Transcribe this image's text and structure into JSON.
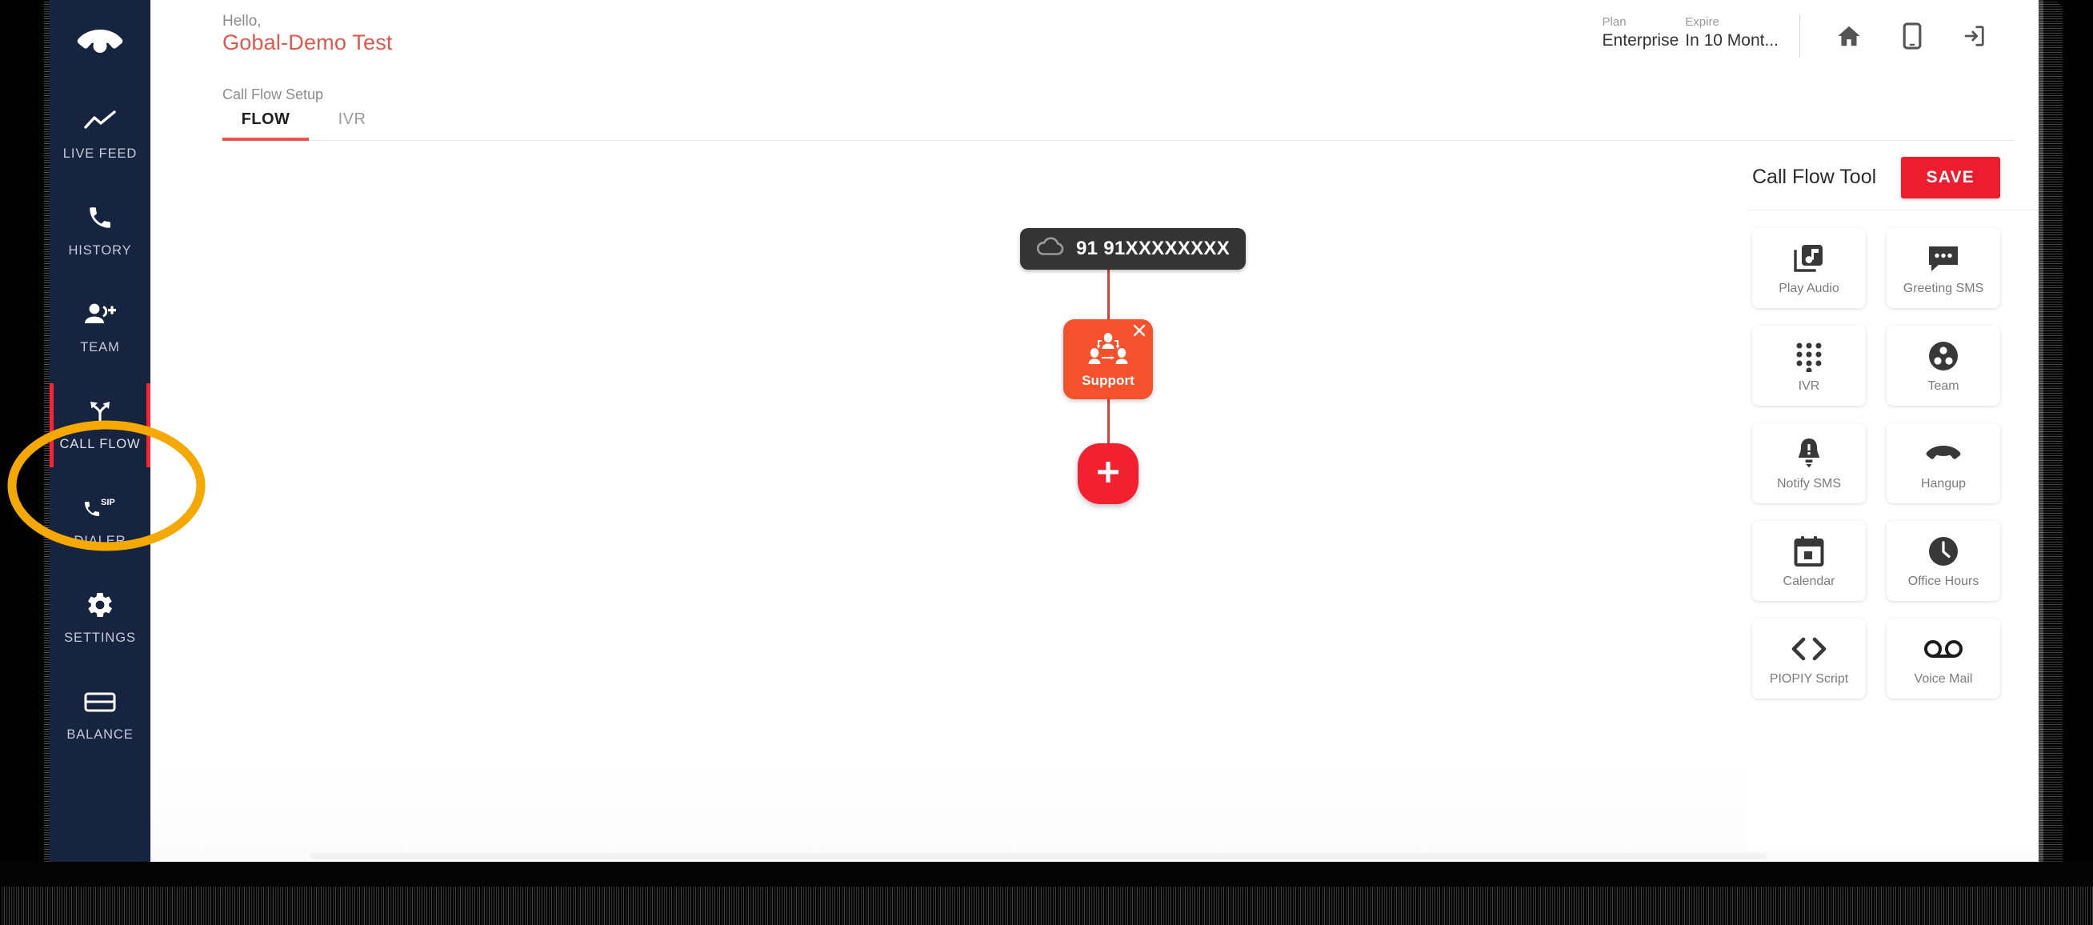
{
  "sidebar": {
    "logo_icon": "hangup-phone-logo-icon",
    "items": [
      {
        "label": "LIVE FEED",
        "icon": "trending-up-icon",
        "active": false
      },
      {
        "label": "HISTORY",
        "icon": "phone-icon",
        "active": false
      },
      {
        "label": "TEAM",
        "icon": "person-add-icon",
        "active": false
      },
      {
        "label": "CALL FLOW",
        "icon": "call-split-icon",
        "active": true
      },
      {
        "label": "DIALER",
        "icon": "sip-phone-icon",
        "active": false
      },
      {
        "label": "SETTINGS",
        "icon": "gear-icon",
        "active": false
      },
      {
        "label": "BALANCE",
        "icon": "credit-card-icon",
        "active": false
      }
    ]
  },
  "header": {
    "hello_label": "Hello,",
    "account_name": "Gobal-Demo Test",
    "plan_key": "Plan",
    "plan_value": "Enterprise",
    "expire_key": "Expire",
    "expire_value": "In 10 Mont...",
    "icons": [
      {
        "name": "home-icon"
      },
      {
        "name": "mobile-icon"
      },
      {
        "name": "logout-icon"
      }
    ]
  },
  "subheader": {
    "breadcrumb": "Call Flow Setup",
    "tabs": [
      {
        "label": "FLOW",
        "active": true
      },
      {
        "label": "IVR",
        "active": false
      }
    ]
  },
  "flow": {
    "number_badge": {
      "icon": "cloud-icon",
      "text": "91 91XXXXXXXX"
    },
    "node": {
      "label": "Support",
      "icon": "team-network-icon",
      "close_icon": "close-icon",
      "color": "#f4512c"
    },
    "add_button": {
      "icon": "plus-icon",
      "color": "#f3212f"
    },
    "connector_color": "#e13b3b"
  },
  "tool_panel": {
    "title": "Call Flow Tool",
    "save_label": "SAVE",
    "save_color": "#ed1c2e",
    "tools": [
      {
        "label": "Play Audio",
        "icon": "library-music-icon"
      },
      {
        "label": "Greeting SMS",
        "icon": "chat-bubble-icon"
      },
      {
        "label": "IVR",
        "icon": "dialpad-icon"
      },
      {
        "label": "Team",
        "icon": "group-circle-icon"
      },
      {
        "label": "Notify SMS",
        "icon": "bell-alert-icon"
      },
      {
        "label": "Hangup",
        "icon": "hangup-phone-icon"
      },
      {
        "label": "Calendar",
        "icon": "calendar-icon"
      },
      {
        "label": "Office Hours",
        "icon": "clock-icon"
      },
      {
        "label": "PIOPIY Script",
        "icon": "code-brackets-icon"
      },
      {
        "label": "Voice Mail",
        "icon": "voicemail-icon"
      }
    ]
  },
  "annotation": {
    "shape": "ellipse-highlight",
    "color": "#f5a800",
    "target": "CALL FLOW"
  },
  "theme": {
    "sidebar_bg": "#17243f",
    "accent_red": "#ef5350",
    "brand_red": "#e2574c",
    "active_marker": "#fb2233"
  }
}
